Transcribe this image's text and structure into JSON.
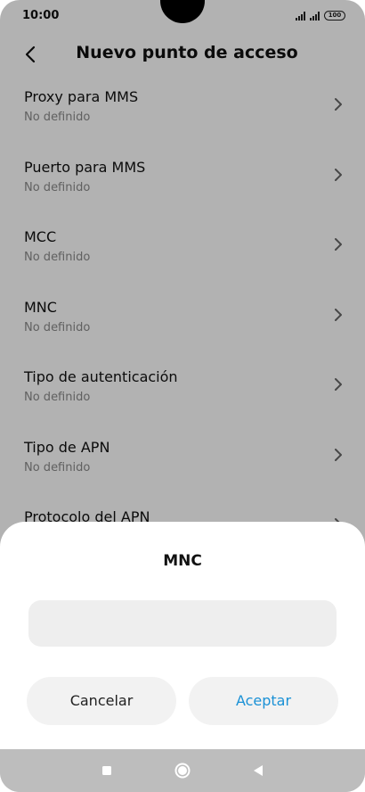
{
  "status_bar": {
    "time": "10:00",
    "battery": "100"
  },
  "header": {
    "title": "Nuevo punto de acceso"
  },
  "settings": [
    {
      "title": "Proxy para MMS",
      "value": "No definido"
    },
    {
      "title": "Puerto para MMS",
      "value": "No definido"
    },
    {
      "title": "MCC",
      "value": "No definido"
    },
    {
      "title": "MNC",
      "value": "No definido"
    },
    {
      "title": "Tipo de autenticación",
      "value": "No definido"
    },
    {
      "title": "Tipo de APN",
      "value": "No definido"
    },
    {
      "title": "Protocolo del APN",
      "value": ""
    }
  ],
  "dialog": {
    "title": "MNC",
    "input_value": "",
    "cancel_label": "Cancelar",
    "ok_label": "Aceptar"
  },
  "colors": {
    "accent": "#1a91d6",
    "overlay": "#000000"
  }
}
